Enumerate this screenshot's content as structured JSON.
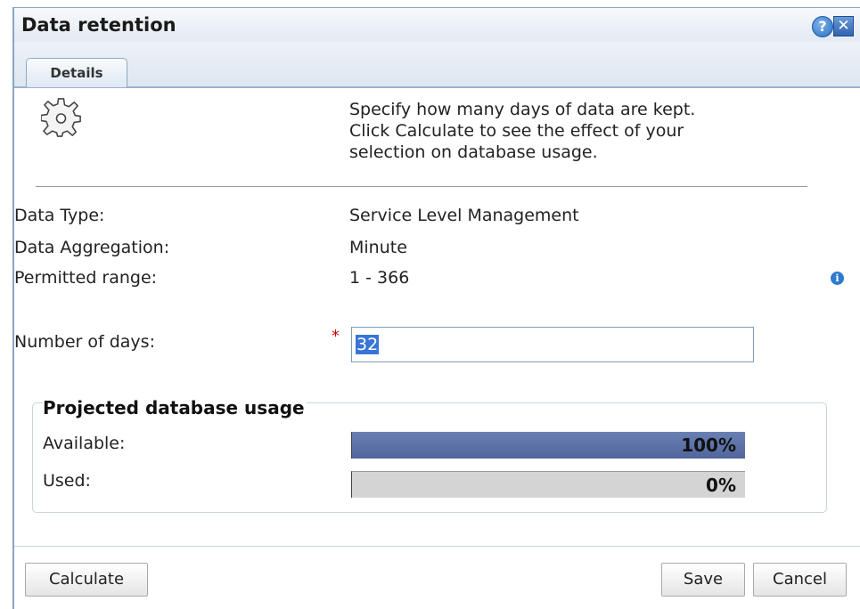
{
  "dialog": {
    "title": "Data retention",
    "help_glyph": "?",
    "close_glyph": "✕"
  },
  "tabs": [
    {
      "label": "Details",
      "active": true
    }
  ],
  "intro": {
    "icon": "gear-icon",
    "lines": [
      "Specify how many days of data are kept.",
      "Click Calculate to see the effect of your",
      "selection on database usage."
    ]
  },
  "info": [
    {
      "label": "Data Type:",
      "value": "Service Level Management"
    },
    {
      "label": "Data Aggregation:",
      "value": "Minute"
    },
    {
      "label": "Permitted range:",
      "value": "1 - 366"
    }
  ],
  "days": {
    "label": "Number of days:",
    "required_marker": "*",
    "value": "32"
  },
  "usage": {
    "title": "Projected database usage",
    "available": {
      "label": "Available:",
      "text": "100%",
      "fraction": 1.0
    },
    "used": {
      "label": "Used:",
      "text": "0%",
      "fraction": 0.0
    }
  },
  "buttons": {
    "calculate": "Calculate",
    "save": "Save",
    "cancel": "Cancel"
  },
  "colors": {
    "accent": "#2e7ad0",
    "bar_fill": "#5b70a6",
    "required": "#d40000"
  }
}
